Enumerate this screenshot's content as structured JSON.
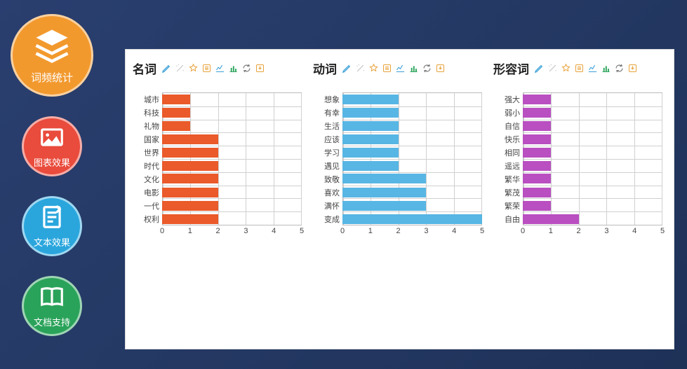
{
  "sidebar": {
    "items": [
      {
        "label": "词频统计",
        "color": "orange",
        "icon": "layers-icon"
      },
      {
        "label": "图表效果",
        "color": "red",
        "icon": "image-icon"
      },
      {
        "label": "文本效果",
        "color": "blue",
        "icon": "note-icon"
      },
      {
        "label": "文档支持",
        "color": "green",
        "icon": "book-icon"
      }
    ]
  },
  "toolbar_icons": [
    "pencil-icon",
    "wand-icon",
    "star-icon",
    "list-icon",
    "linechart-icon",
    "barchart-icon",
    "refresh-icon",
    "save-icon"
  ],
  "charts": [
    {
      "title": "名词",
      "color": "#ea5a2b"
    },
    {
      "title": "动词",
      "color": "#58b6e4"
    },
    {
      "title": "形容词",
      "color": "#b94fc1"
    }
  ],
  "chart_data": [
    {
      "type": "bar",
      "title": "名词",
      "orientation": "horizontal",
      "xlabel": "",
      "ylabel": "",
      "xlim": [
        0,
        5
      ],
      "xticks": [
        0,
        1,
        2,
        3,
        4,
        5
      ],
      "categories": [
        "城市",
        "科技",
        "礼物",
        "国家",
        "世界",
        "时代",
        "文化",
        "电影",
        "一代",
        "权利"
      ],
      "values": [
        1,
        1,
        1,
        2,
        2,
        2,
        2,
        2,
        2,
        2
      ]
    },
    {
      "type": "bar",
      "title": "动词",
      "orientation": "horizontal",
      "xlabel": "",
      "ylabel": "",
      "xlim": [
        0,
        5
      ],
      "xticks": [
        0,
        1,
        2,
        3,
        4,
        5
      ],
      "categories": [
        "想象",
        "有幸",
        "生活",
        "应该",
        "学习",
        "遇见",
        "致敬",
        "喜欢",
        "满怀",
        "变成"
      ],
      "values": [
        2,
        2,
        2,
        2,
        2,
        2,
        3,
        3,
        3,
        5
      ]
    },
    {
      "type": "bar",
      "title": "形容词",
      "orientation": "horizontal",
      "xlabel": "",
      "ylabel": "",
      "xlim": [
        0,
        5
      ],
      "xticks": [
        0,
        1,
        2,
        3,
        4,
        5
      ],
      "categories": [
        "强大",
        "弱小",
        "自信",
        "快乐",
        "相同",
        "遥远",
        "繁华",
        "繁茂",
        "繁荣",
        "自由"
      ],
      "values": [
        1,
        1,
        1,
        1,
        1,
        1,
        1,
        1,
        1,
        2
      ]
    }
  ]
}
